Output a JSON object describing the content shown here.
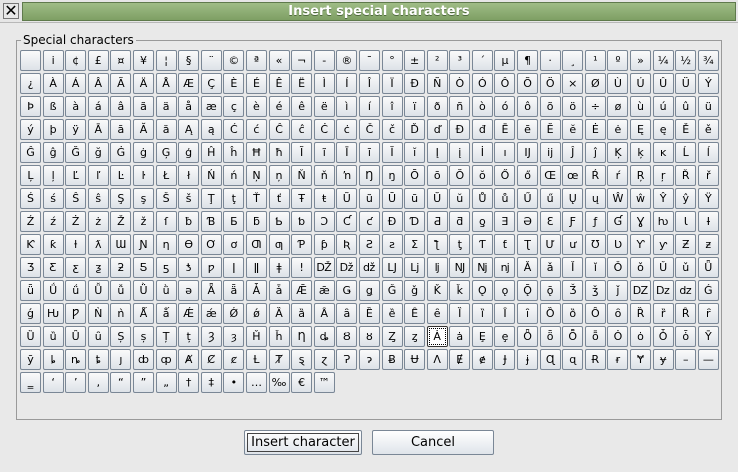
{
  "window": {
    "title": "Insert special characters",
    "close_glyph": "✕"
  },
  "group": {
    "label": "Special characters"
  },
  "characters": [
    " ",
    "i",
    "¢",
    "£",
    "¤",
    "¥",
    "¦",
    "§",
    "¨",
    "©",
    "ª",
    "«",
    "¬",
    "-",
    "®",
    "¯",
    "°",
    "±",
    "²",
    "³",
    "´",
    "µ",
    "¶",
    "·",
    "¸",
    "¹",
    "º",
    "»",
    "¼",
    "½",
    "¾",
    "¿",
    "À",
    "Á",
    "Â",
    "Ã",
    "Ä",
    "Å",
    "Æ",
    "Ç",
    "È",
    "É",
    "Ê",
    "Ë",
    "Ì",
    "Í",
    "Î",
    "Ï",
    "Ð",
    "Ñ",
    "Ò",
    "Ó",
    "Ô",
    "Õ",
    "Ö",
    "×",
    "Ø",
    "Ù",
    "Ú",
    "Û",
    "Ü",
    "Ý",
    "Þ",
    "ß",
    "à",
    "á",
    "â",
    "ã",
    "ä",
    "å",
    "æ",
    "ç",
    "è",
    "é",
    "ê",
    "ë",
    "ì",
    "í",
    "î",
    "ï",
    "ð",
    "ñ",
    "ò",
    "ó",
    "ô",
    "õ",
    "ö",
    "÷",
    "ø",
    "ù",
    "ú",
    "û",
    "ü",
    "ý",
    "þ",
    "ÿ",
    "Ā",
    "ā",
    "Ă",
    "ă",
    "Ą",
    "ą",
    "Ć",
    "ć",
    "Ĉ",
    "ĉ",
    "Ċ",
    "ċ",
    "Č",
    "č",
    "Ď",
    "ď",
    "Đ",
    "đ",
    "Ē",
    "ē",
    "Ĕ",
    "ĕ",
    "Ė",
    "ė",
    "Ę",
    "ę",
    "Ě",
    "ě",
    "Ĝ",
    "ĝ",
    "Ğ",
    "ğ",
    "Ġ",
    "ġ",
    "Ģ",
    "ģ",
    "Ĥ",
    "ĥ",
    "Ħ",
    "ħ",
    "Ĩ",
    "ĩ",
    "Ī",
    "ī",
    "Ĭ",
    "ĭ",
    "Į",
    "į",
    "İ",
    "ı",
    "Ĳ",
    "ĳ",
    "Ĵ",
    "ĵ",
    "Ķ",
    "ķ",
    "ĸ",
    "Ĺ",
    "ĺ",
    "Ļ",
    "ļ",
    "Ľ",
    "ľ",
    "Ŀ",
    "ŀ",
    "Ł",
    "ł",
    "Ń",
    "ń",
    "Ņ",
    "ņ",
    "Ň",
    "ň",
    "ŉ",
    "Ŋ",
    "ŋ",
    "Ō",
    "ō",
    "Ŏ",
    "ŏ",
    "Ő",
    "ő",
    "Œ",
    "œ",
    "Ŕ",
    "ŕ",
    "Ŗ",
    "ŗ",
    "Ř",
    "ř",
    "Ś",
    "ś",
    "Ŝ",
    "ŝ",
    "Ş",
    "ş",
    "Š",
    "š",
    "Ţ",
    "ţ",
    "Ť",
    "ť",
    "Ŧ",
    "ŧ",
    "Ũ",
    "ũ",
    "Ū",
    "ū",
    "Ŭ",
    "ŭ",
    "Ů",
    "ů",
    "Ű",
    "ű",
    "Ų",
    "ų",
    "Ŵ",
    "ŵ",
    "Ŷ",
    "ŷ",
    "Ÿ",
    "Ź",
    "ź",
    "Ż",
    "ż",
    "Ž",
    "ž",
    "ſ",
    "ƀ",
    "Ɓ",
    "Ƃ",
    "ƃ",
    "Ƅ",
    "ƅ",
    "Ɔ",
    "Ƈ",
    "ƈ",
    "Ɖ",
    "Ɗ",
    "Ƌ",
    "ƌ",
    "ƍ",
    "Ǝ",
    "Ə",
    "Ɛ",
    "Ƒ",
    "ƒ",
    "Ɠ",
    "Ɣ",
    "ƕ",
    "Ɩ",
    "Ɨ",
    "Ƙ",
    "ƙ",
    "ƚ",
    "ƛ",
    "Ɯ",
    "Ɲ",
    "ƞ",
    "Ɵ",
    "Ơ",
    "ơ",
    "Ƣ",
    "ƣ",
    "Ƥ",
    "ƥ",
    "Ʀ",
    "Ƨ",
    "ƨ",
    "Ʃ",
    "ƪ",
    "ƫ",
    "Ƭ",
    "ƭ",
    "Ʈ",
    "Ư",
    "ư",
    "Ʊ",
    "Ʋ",
    "Ƴ",
    "ƴ",
    "Ƶ",
    "ƶ",
    "Ʒ",
    "Ƹ",
    "ƹ",
    "ƺ",
    "ƻ",
    "Ƽ",
    "ƽ",
    "ƾ",
    "ƿ",
    "ǀ",
    "ǁ",
    "ǂ",
    "ǃ",
    "Ǆ",
    "ǅ",
    "ǆ",
    "Ǉ",
    "ǈ",
    "ǉ",
    "Ǌ",
    "ǋ",
    "ǌ",
    "Ǎ",
    "ǎ",
    "Ǐ",
    "ǐ",
    "Ǒ",
    "ǒ",
    "Ǔ",
    "ǔ",
    "Ǖ",
    "ǖ",
    "Ǘ",
    "ǘ",
    "Ǚ",
    "ǚ",
    "Ǜ",
    "ǜ",
    "ǝ",
    "Ǟ",
    "ǟ",
    "Ǡ",
    "ǡ",
    "Ǣ",
    "ǣ",
    "Ǥ",
    "ǥ",
    "Ǧ",
    "ǧ",
    "Ǩ",
    "ǩ",
    "Ǫ",
    "ǫ",
    "Ǭ",
    "ǭ",
    "Ǯ",
    "ǯ",
    "ǰ",
    "Ǳ",
    "ǲ",
    "ǳ",
    "Ǵ",
    "ǵ",
    "Ƕ",
    "Ƿ",
    "Ǹ",
    "ǹ",
    "Ǻ",
    "ǻ",
    "Ǽ",
    "ǽ",
    "Ǿ",
    "ǿ",
    "Ȁ",
    "ȁ",
    "Ȃ",
    "ȃ",
    "Ȅ",
    "ȅ",
    "Ȇ",
    "ȇ",
    "Ȉ",
    "ȉ",
    "Ȋ",
    "ȋ",
    "Ȍ",
    "ȍ",
    "Ȏ",
    "ȏ",
    "Ȑ",
    "ȑ",
    "Ȓ",
    "ȓ",
    "Ȕ",
    "ȕ",
    "Ȗ",
    "ȗ",
    "Ș",
    "ș",
    "Ț",
    "ț",
    "Ȝ",
    "ȝ",
    "Ȟ",
    "ȟ",
    "Ƞ",
    "ȡ",
    "Ȣ",
    "ȣ",
    "Ȥ",
    "ȥ",
    "Ȧ",
    "ȧ",
    "Ȩ",
    "ȩ",
    "Ȫ",
    "ȫ",
    "Ȭ",
    "ȭ",
    "Ȯ",
    "ȯ",
    "Ȱ",
    "ȱ",
    "Ȳ",
    "ȳ",
    "ȴ",
    "ȵ",
    "ȶ",
    "ȷ",
    "ȸ",
    "ȹ",
    "Ⱥ",
    "Ȼ",
    "ȼ",
    "Ƚ",
    "Ⱦ",
    "ȿ",
    "ɀ",
    "Ɂ",
    "ɂ",
    "Ƀ",
    "Ʉ",
    "Ʌ",
    "Ɇ",
    "ɇ",
    "Ɉ",
    "ɉ",
    "Ɋ",
    "ɋ",
    "Ɍ",
    "ɍ",
    "Ɏ",
    "ɏ",
    "–",
    "—",
    "‗",
    "‘",
    "’",
    "‚",
    "“",
    "”",
    "„",
    "†",
    "‡",
    "•",
    "…",
    "‰",
    "€",
    "™"
  ],
  "selected_index": 390,
  "buttons": {
    "insert": "Insert character",
    "cancel": "Cancel"
  }
}
